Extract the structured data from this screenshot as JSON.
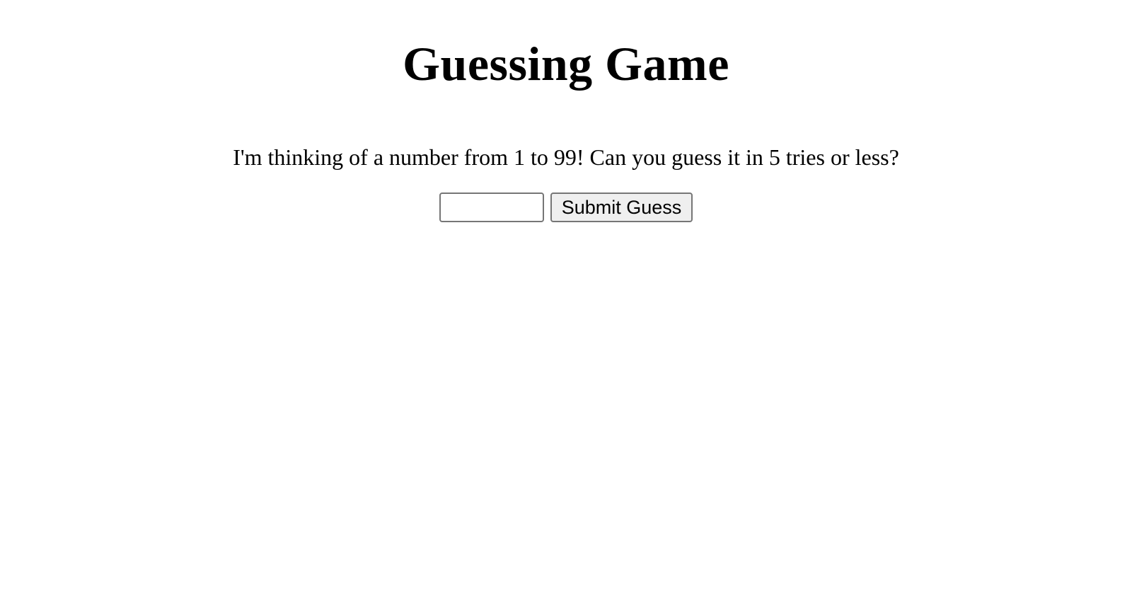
{
  "title": "Guessing Game",
  "instructions": "I'm thinking of a number from 1 to 99! Can you guess it in 5 tries or less?",
  "form": {
    "guess_value": "",
    "guess_placeholder": "",
    "submit_label": "Submit Guess"
  }
}
